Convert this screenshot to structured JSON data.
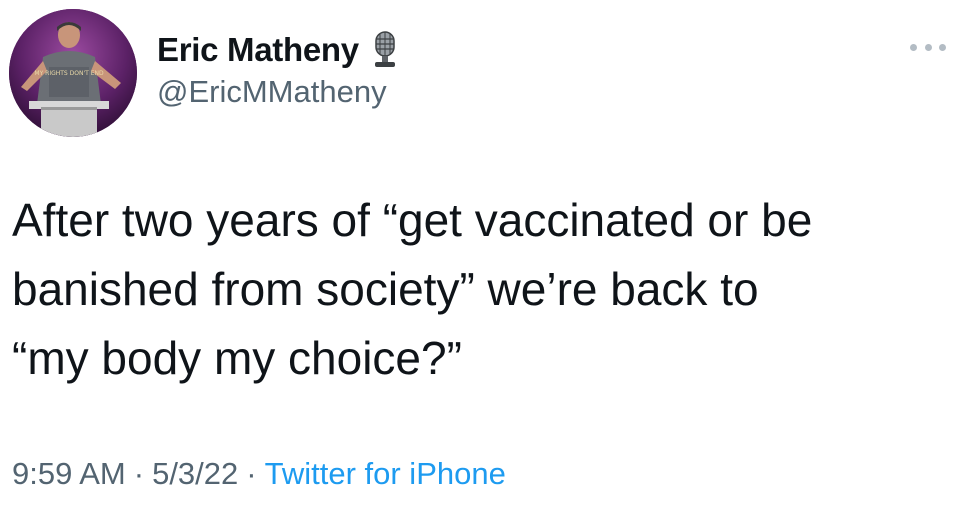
{
  "tweet": {
    "author": {
      "display_name": "Eric Matheny",
      "handle": "@EricMMatheny",
      "badge_icon": "microphone-icon",
      "avatar_shirt_text": "MY RIGHTS DON'T END"
    },
    "more_icon": "ellipsis-icon",
    "text": "After two years of “get vaccinated or be\nbanished from society” we’re back to\n“my body my choice?”",
    "timestamp": {
      "time": "9:59 AM",
      "separator": "·",
      "date": "5/3/22",
      "source": "Twitter for iPhone"
    }
  },
  "colors": {
    "text_primary": "#0f1419",
    "text_secondary": "#536471",
    "link": "#1d9bf0"
  }
}
